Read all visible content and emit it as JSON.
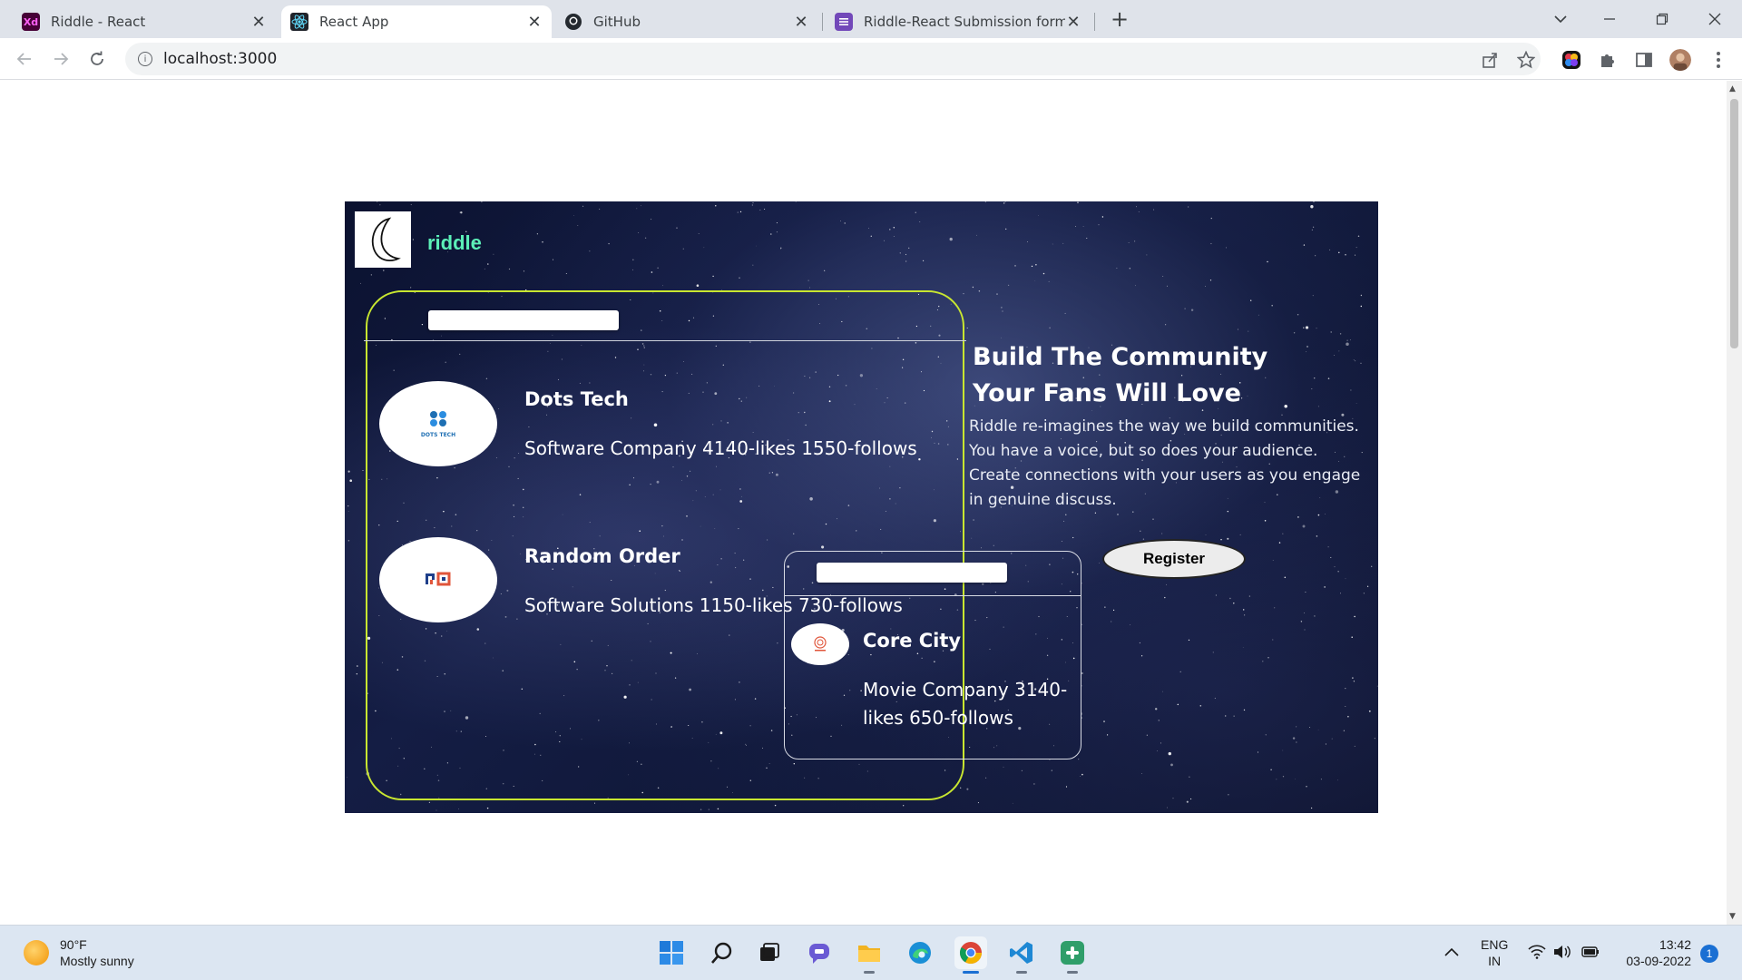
{
  "browser": {
    "tabs": [
      {
        "favicon": "xd-icon",
        "favicon_text": "Xd",
        "title": "Riddle - React"
      },
      {
        "favicon": "react-icon",
        "title": "React App"
      },
      {
        "favicon": "github-icon",
        "title": "GitHub"
      },
      {
        "favicon": "forms-icon",
        "title": "Riddle-React Submission form| H"
      }
    ],
    "new_tab_symbol": "+",
    "close_symbol": "✕",
    "url": "localhost:3000",
    "info_symbol": "i"
  },
  "page": {
    "brand": "riddle",
    "companies": [
      {
        "name": "Dots Tech",
        "desc": "Software Company 4140-likes 1550-follows",
        "logo_text": "DOTS TECH",
        "logo_color": "#1e6fb3"
      },
      {
        "name": "Random Order",
        "desc": "Software Solutions 1150-likes 730-follows",
        "logo_text": "RO",
        "logo_color": "#1e3f8a"
      },
      {
        "name": "Core City",
        "desc": "Movie Company 3140-likes 650-follows",
        "logo_text": "CC",
        "logo_color": "#e0553a"
      }
    ],
    "headline_line1": "Build The Community",
    "headline_line2": "Your Fans Will Love",
    "blurb": "Riddle re-imagines the way we build communities. You have a voice, but so does your audience. Create connections with your users as you engage in genuine discuss.",
    "register_label": "Register",
    "accent_color": "#c8e630",
    "brand_color": "#5cf0b8"
  },
  "taskbar": {
    "weather_temp": "90°F",
    "weather_desc": "Mostly sunny",
    "lang_line1": "ENG",
    "lang_line2": "IN",
    "time": "13:42",
    "date": "03-09-2022",
    "notification_count": "1"
  }
}
